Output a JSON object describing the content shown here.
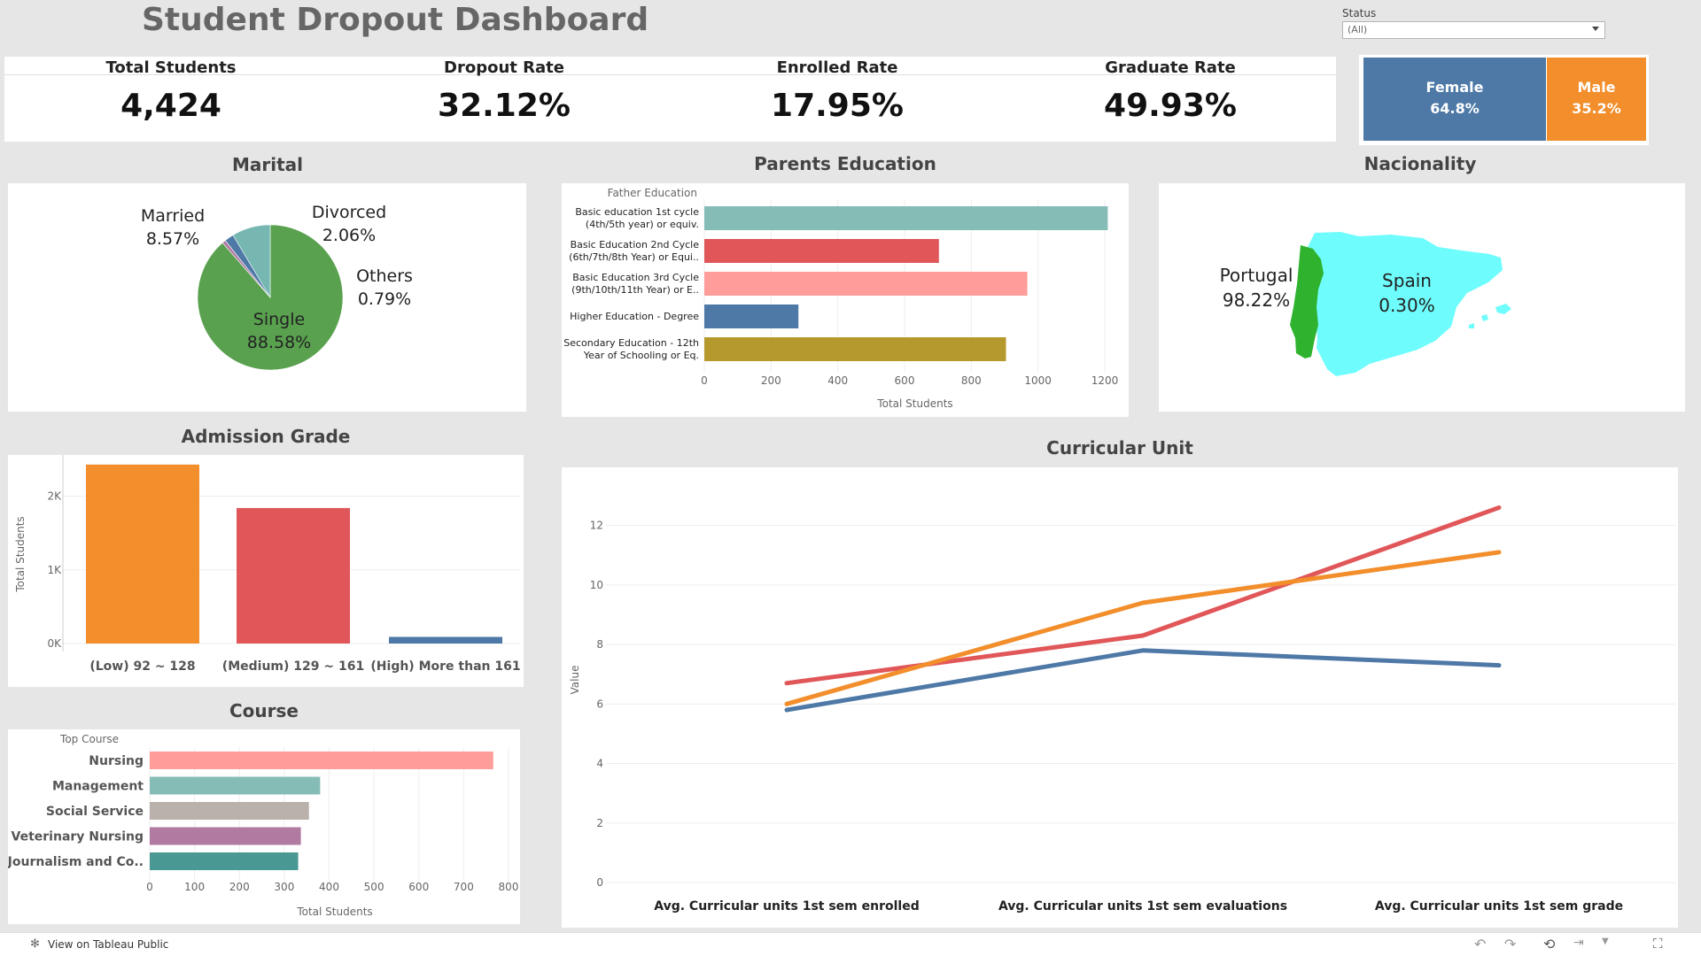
{
  "header": {
    "title": "Student Dropout Dashboard",
    "filter_label": "Status",
    "filter_value": "(All)"
  },
  "kpis": [
    {
      "label": "Total Students",
      "value": "4,424"
    },
    {
      "label": "Dropout Rate",
      "value": "32.12%"
    },
    {
      "label": "Enrolled Rate",
      "value": "17.95%"
    },
    {
      "label": "Graduate Rate",
      "value": "49.93%"
    }
  ],
  "gender": {
    "female": {
      "label": "Female",
      "value": "64.8%",
      "share": 0.648,
      "color": "#4e79a7"
    },
    "male": {
      "label": "Male",
      "value": "35.2%",
      "share": 0.352,
      "color": "#f28e2b"
    }
  },
  "marital": {
    "title": "Marital",
    "slices": [
      {
        "name": "Single",
        "value": 88.58,
        "label": "88.58%",
        "color": "#59a14f"
      },
      {
        "name": "Married",
        "value": 8.57,
        "label": "8.57%",
        "color": "#76b7b2"
      },
      {
        "name": "Divorced",
        "value": 2.06,
        "label": "2.06%",
        "color": "#4e79a7"
      },
      {
        "name": "Others",
        "value": 0.79,
        "label": "0.79%",
        "color": "#b07aa1"
      }
    ]
  },
  "parents": {
    "title": "Parents Education",
    "field_label": "Father Education",
    "x_label": "Total Students",
    "ticks": [
      "0",
      "200",
      "400",
      "600",
      "800",
      "1000",
      "1200"
    ],
    "xmax": 1200,
    "bars": [
      {
        "l1": "Basic education 1st cycle",
        "l2": "(4th/5th year) or equiv.",
        "value": 1209,
        "color": "#86bcb6"
      },
      {
        "l1": "Basic Education 2nd Cycle",
        "l2": "(6th/7th/8th Year) or Equi..",
        "value": 703,
        "color": "#e15759"
      },
      {
        "l1": "Basic Education 3rd Cycle",
        "l2": "(9th/10th/11th Year) or E..",
        "value": 968,
        "color": "#ff9d9a"
      },
      {
        "l1": "Higher Education - Degree",
        "l2": "",
        "value": 282,
        "color": "#4e79a7"
      },
      {
        "l1": "Secondary Education - 12th",
        "l2": "Year of Schooling or Eq.",
        "value": 904,
        "color": "#b6992d"
      }
    ]
  },
  "nationality": {
    "title": "Nacionality",
    "portugal": {
      "name": "Portugal",
      "value": "98.22%",
      "color": "#2fb32f"
    },
    "spain": {
      "name": "Spain",
      "value": "0.30%",
      "color": "#6ffcfc"
    }
  },
  "admission": {
    "title": "Admission Grade",
    "y_label": "Total Students",
    "ticks": [
      "0K",
      "1K",
      "2K"
    ],
    "ymax": 2500,
    "bars": [
      {
        "label": "(Low)  92 ~ 128",
        "value": 2430,
        "color": "#f28e2b"
      },
      {
        "label": "(Medium) 129 ~ 161",
        "value": 1840,
        "color": "#e15759"
      },
      {
        "label": "(High) More than 161",
        "value": 90,
        "color": "#4e79a7"
      }
    ]
  },
  "course": {
    "title": "Course",
    "field_label": "Top Course",
    "x_label": "Total Students",
    "ticks": [
      "0",
      "100",
      "200",
      "300",
      "400",
      "500",
      "600",
      "700",
      "800"
    ],
    "xmax": 800,
    "bars": [
      {
        "label": "Nursing",
        "value": 766,
        "color": "#ff9d9a"
      },
      {
        "label": "Management",
        "value": 380,
        "color": "#86bcb6"
      },
      {
        "label": "Social Service",
        "value": 355,
        "color": "#bab0ac"
      },
      {
        "label": "Veterinary Nursing",
        "value": 337,
        "color": "#b07aa1"
      },
      {
        "label": "Journalism and Co..",
        "value": 331,
        "color": "#499894"
      }
    ]
  },
  "curricular": {
    "title": "Curricular Unit",
    "y_label": "Value",
    "ticks": [
      "0",
      "2",
      "4",
      "6",
      "8",
      "10",
      "12"
    ],
    "ymax": 13,
    "categories": [
      "Avg. Curricular units 1st sem enrolled",
      "Avg. Curricular units 1st sem evaluations",
      "Avg. Curricular units 1st sem grade"
    ],
    "series": [
      {
        "values": [
          6.7,
          8.3,
          12.6
        ],
        "color": "#e15759"
      },
      {
        "values": [
          6.0,
          9.4,
          11.1
        ],
        "color": "#f28e2b"
      },
      {
        "values": [
          5.8,
          7.8,
          7.3
        ],
        "color": "#4e79a7"
      }
    ]
  },
  "footer": {
    "view_label": "View on Tableau Public"
  }
}
